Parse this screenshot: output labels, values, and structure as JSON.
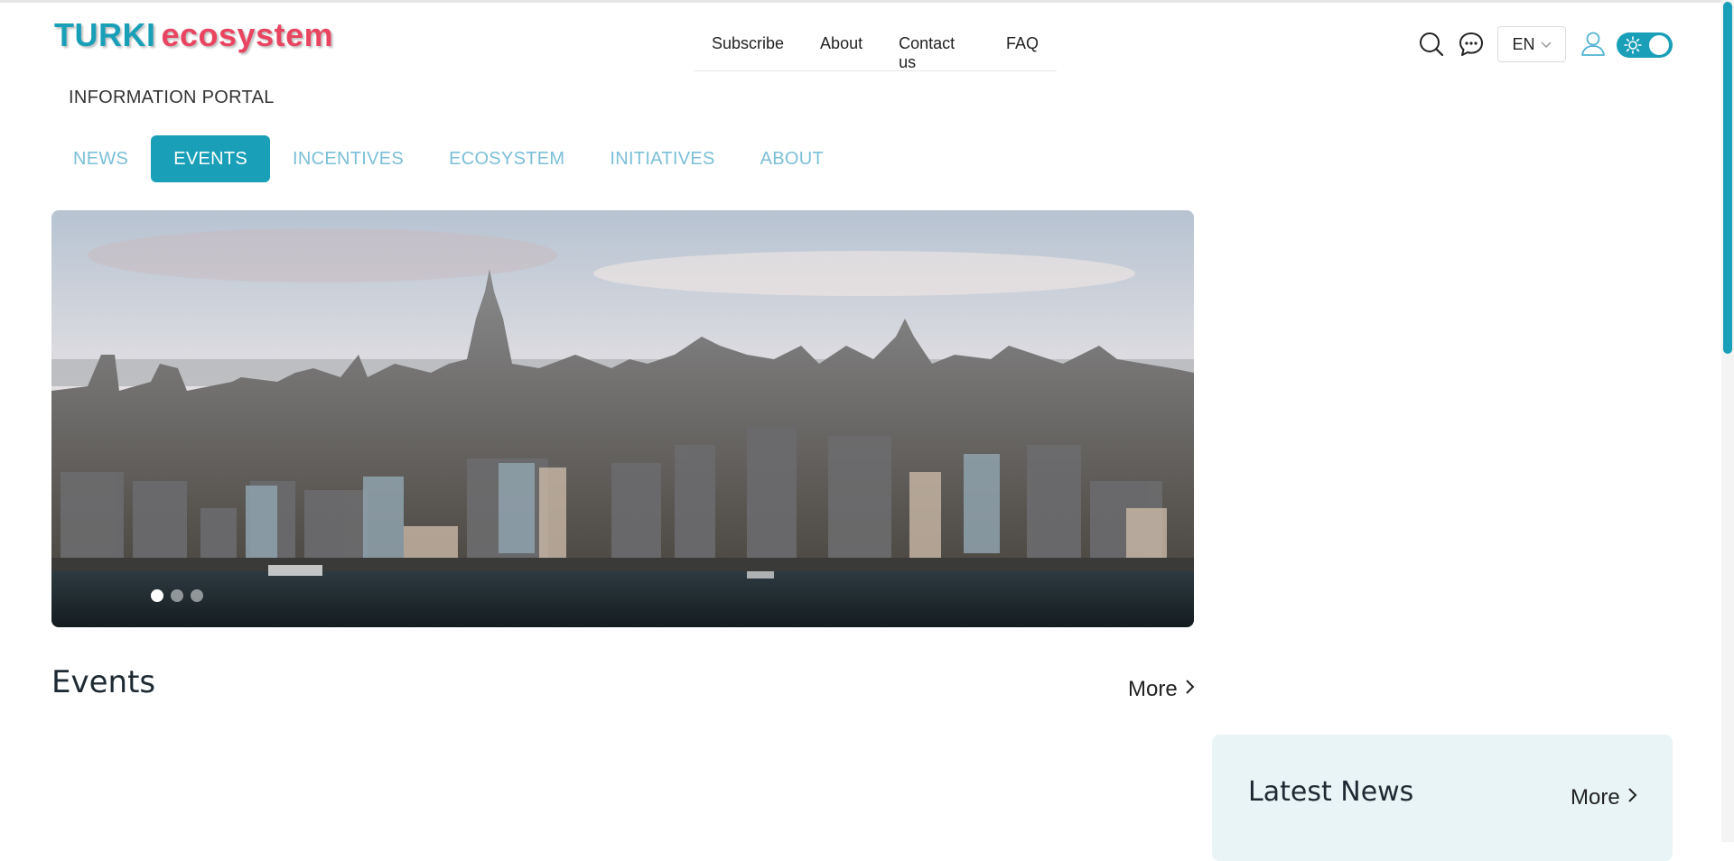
{
  "logo": {
    "part1": "TURKI",
    "part2": "ecosystem"
  },
  "top_nav": [
    {
      "label": "Subscribe"
    },
    {
      "label": "About"
    },
    {
      "label": "Contact us"
    },
    {
      "label": "FAQ"
    }
  ],
  "tools": {
    "language": "EN",
    "icons": [
      "search-icon",
      "chat-icon",
      "chevron-down-icon",
      "user-icon",
      "sun-icon"
    ]
  },
  "portal_label": "INFORMATION PORTAL",
  "tabs": [
    {
      "label": "NEWS",
      "active": false
    },
    {
      "label": "EVENTS",
      "active": true
    },
    {
      "label": "INCENTIVES",
      "active": false
    },
    {
      "label": "ECOSYSTEM",
      "active": false
    },
    {
      "label": "INITIATIVES",
      "active": false
    },
    {
      "label": "ABOUT",
      "active": false
    }
  ],
  "hero": {
    "slide_count": 3,
    "active_slide": 1
  },
  "events": {
    "title": "Events",
    "more_label": "More"
  },
  "latest_news": {
    "title": "Latest News",
    "more_label": "More"
  },
  "colors": {
    "accent": "#1a9fb8",
    "logo_red": "#e94560",
    "tab_inactive": "#7bbfd8",
    "news_panel_bg": "#e9f4f6"
  }
}
